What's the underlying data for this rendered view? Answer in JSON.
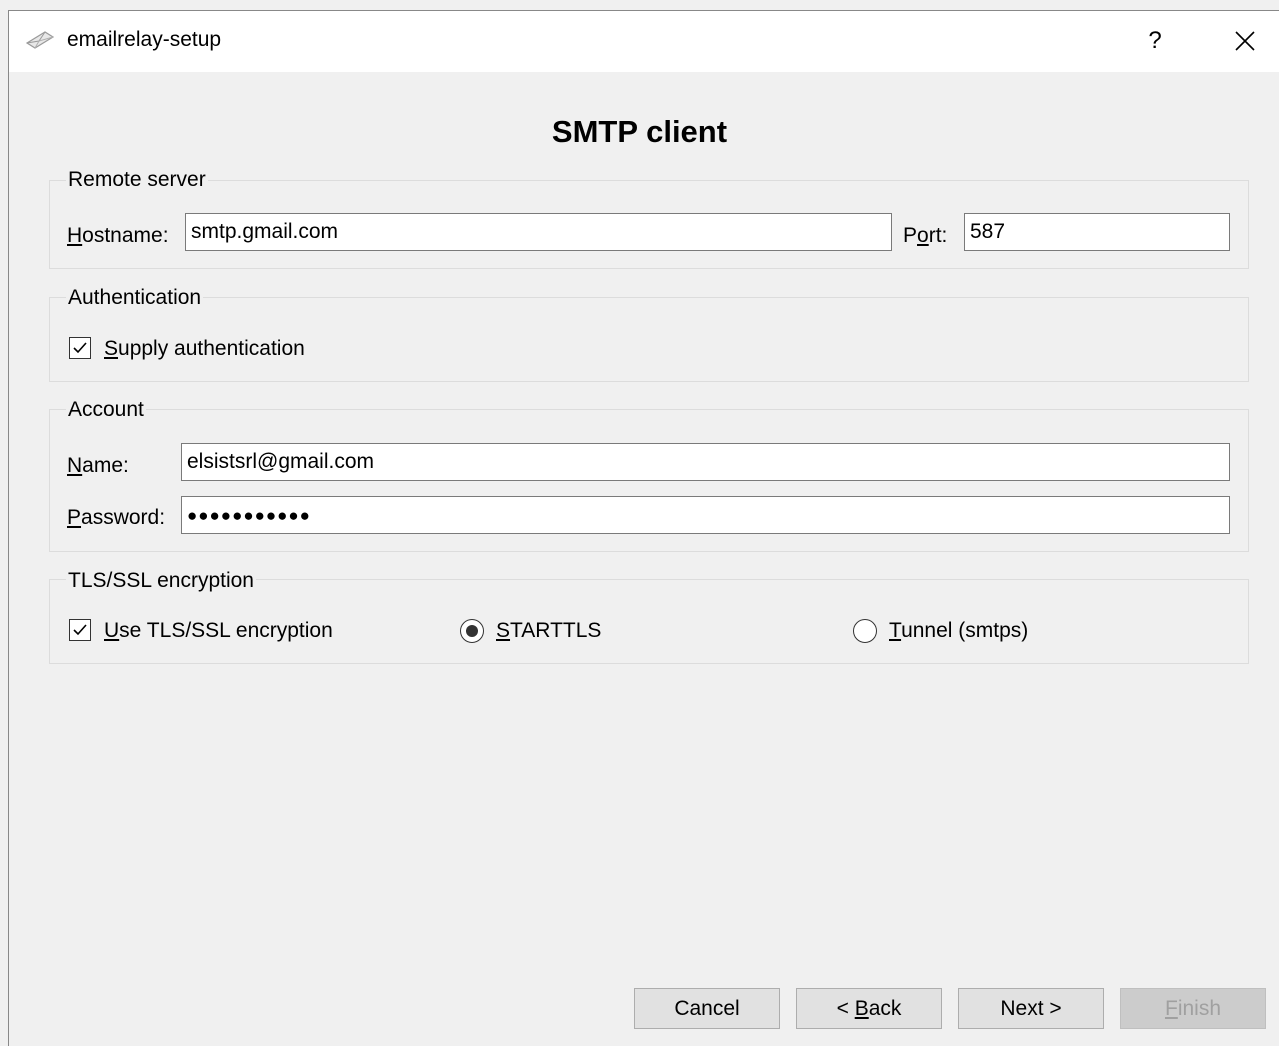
{
  "window": {
    "title": "emailrelay-setup",
    "help_label": "?",
    "icon": "envelope-icon",
    "close_icon": "close-icon"
  },
  "page_heading": "SMTP client",
  "remote_server": {
    "group_title": "Remote server",
    "hostname_label_ul": "H",
    "hostname_label_rest": "ostname:",
    "hostname_value": "smtp.gmail.com",
    "port_label_pre": "P",
    "port_label_ul": "o",
    "port_label_post": "rt:",
    "port_value": "587"
  },
  "authentication": {
    "group_title": "Authentication",
    "checkbox_ul": "S",
    "checkbox_rest": "upply authentication",
    "checked": true
  },
  "account": {
    "group_title": "Account",
    "name_label_ul": "N",
    "name_label_rest": "ame:",
    "name_value": "elsistsrl@gmail.com",
    "password_label_ul": "P",
    "password_label_rest": "assword:",
    "password_mask": "●●●●●●●●●●●"
  },
  "tls": {
    "group_title": "TLS/SSL encryption",
    "use_ul": "U",
    "use_rest": "se TLS/SSL encryption",
    "use_checked": true,
    "starttls_ul": "S",
    "starttls_rest": "TARTTLS",
    "starttls_selected": true,
    "tunnel_ul": "T",
    "tunnel_rest": "unnel (smtps)",
    "tunnel_selected": false
  },
  "buttons": {
    "cancel": "Cancel",
    "back_pre": "< ",
    "back_ul": "B",
    "back_rest": "ack",
    "next": "Next >",
    "finish_ul": "F",
    "finish_rest": "inish"
  }
}
